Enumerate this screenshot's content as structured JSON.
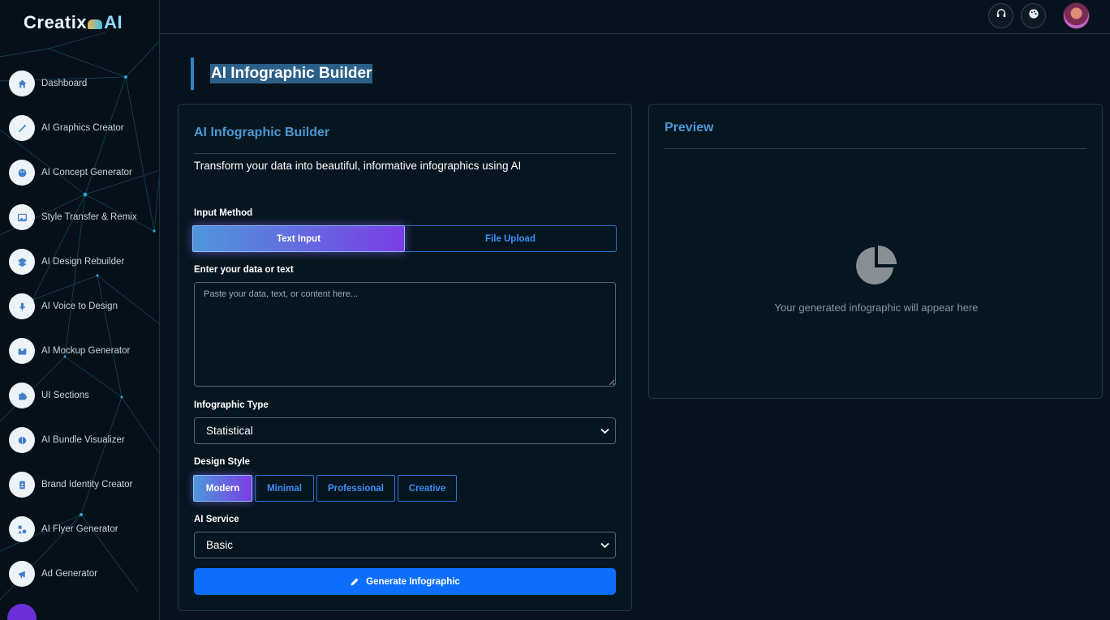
{
  "brand": {
    "name_part1": "Creatix",
    "name_part2": "AI"
  },
  "sidebar": {
    "items": [
      {
        "label": "Dashboard",
        "icon": "home-icon"
      },
      {
        "label": "AI Graphics Creator",
        "icon": "magic-wand-icon"
      },
      {
        "label": "AI Concept Generator",
        "icon": "palette-icon"
      },
      {
        "label": "Style Transfer & Remix",
        "icon": "image-icon"
      },
      {
        "label": "AI Design Rebuilder",
        "icon": "layers-icon"
      },
      {
        "label": "AI Voice to Design",
        "icon": "microphone-icon"
      },
      {
        "label": "AI Mockup Generator",
        "icon": "box-icon"
      },
      {
        "label": "UI Sections",
        "icon": "puzzle-icon"
      },
      {
        "label": "AI Bundle Visualizer",
        "icon": "brain-icon"
      },
      {
        "label": "Brand Identity Creator",
        "icon": "id-badge-icon"
      },
      {
        "label": "AI Flyer Generator",
        "icon": "shapes-icon"
      },
      {
        "label": "Ad Generator",
        "icon": "megaphone-icon"
      }
    ]
  },
  "topbar": {
    "support_icon": "headset-icon",
    "theme_icon": "palette-icon",
    "avatar": "user-avatar"
  },
  "page": {
    "heading": "AI Infographic Builder"
  },
  "builder": {
    "title": "AI Infographic Builder",
    "subtitle": "Transform your data into beautiful, informative infographics using AI",
    "input_method_label": "Input Method",
    "input_methods": [
      "Text Input",
      "File Upload"
    ],
    "selected_input_method": "Text Input",
    "data_label": "Enter your data or text",
    "data_placeholder": "Paste your data, text, or content here...",
    "data_value": "",
    "type_label": "Infographic Type",
    "type_value": "Statistical",
    "style_label": "Design Style",
    "styles": [
      "Modern",
      "Minimal",
      "Professional",
      "Creative"
    ],
    "selected_style": "Modern",
    "service_label": "AI Service",
    "service_value": "Basic",
    "generate_label": "Generate Infographic"
  },
  "preview": {
    "title": "Preview",
    "empty_text": "Your generated infographic will appear here"
  },
  "colors": {
    "accent": "#0d6efd",
    "title_blue": "#4d97d4",
    "background": "#06131c"
  }
}
